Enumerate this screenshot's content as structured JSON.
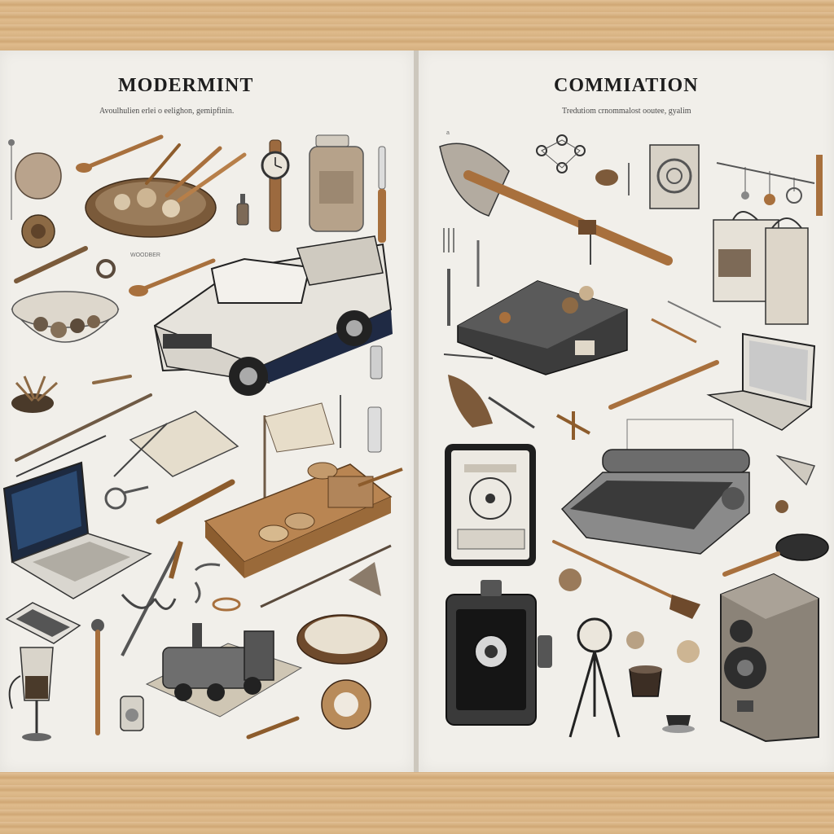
{
  "left_poster": {
    "title": "MODERMINT",
    "subtitle": "Avoulhulien erlei o eelighon, gemipfinin.",
    "small_label": "WOODBER"
  },
  "right_poster": {
    "title": "COMMIATION",
    "subtitle": "Tredutiom crnommalost ooutee, gyalim",
    "corner_mark": "a"
  },
  "colors": {
    "paper": "#f1efea",
    "ink": "#2a2a2a",
    "wood_light": "#d8b586",
    "wood_handle": "#a8703d",
    "truck_navy": "#1f2a44",
    "screen_blue": "#2b4a72"
  },
  "illustrations": {
    "left": [
      "bowl-of-food-icon",
      "pickup-truck-icon",
      "laptop-icon",
      "wristwatch-icon",
      "glass-jar-icon",
      "wooden-spoon-icon",
      "wooden-board-icon",
      "toy-train-icon",
      "goblet-icon",
      "flag-icon",
      "notebook-icon",
      "phone-icon"
    ],
    "right": [
      "pickaxe-icon",
      "vintage-typewriter-icon",
      "laptop-icon",
      "radio-cassette-player-icon",
      "tablet-device-icon",
      "retro-speaker-icon",
      "portable-radio-icon",
      "tripod-lamp-icon",
      "fork-icon",
      "coffee-cup-icon",
      "brush-icon"
    ]
  }
}
